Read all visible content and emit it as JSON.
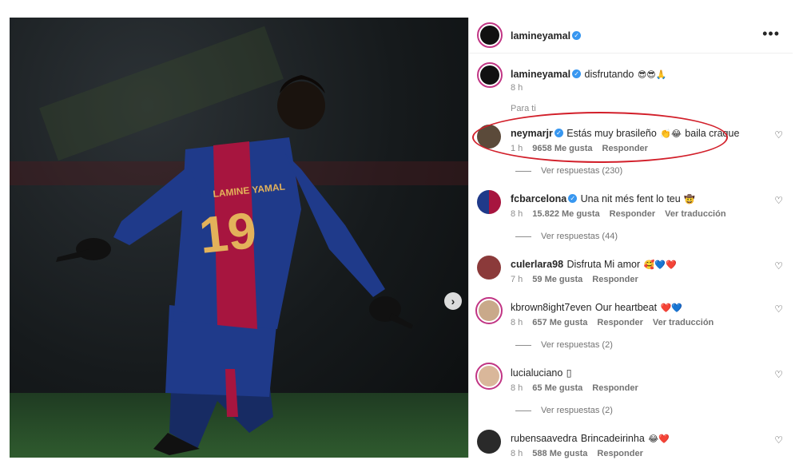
{
  "post": {
    "author": "lamineyamal",
    "caption": "disfrutando",
    "caption_emoji": "😎😎🙏",
    "caption_time": "8 h",
    "section_label": "Para ti"
  },
  "comments": [
    {
      "user": "neymarjr",
      "verified": true,
      "text": "Estás muy brasileño",
      "emoji1": "👏😂",
      "text2": "baila craque",
      "time": "1 h",
      "likes": "9658 Me gusta",
      "reply": "Responder",
      "translate": "",
      "view_replies": "Ver respuestas (230)"
    },
    {
      "user": "fcbarcelona",
      "verified": true,
      "text": "Una nit més fent lo teu",
      "emoji1": "🤠",
      "text2": "",
      "time": "8 h",
      "likes": "15.822 Me gusta",
      "reply": "Responder",
      "translate": "Ver traducción",
      "view_replies": "Ver respuestas (44)"
    },
    {
      "user": "culerlara98",
      "verified": false,
      "text": "Disfruta Mi amor",
      "emoji1": "🥰💙❤️",
      "text2": "",
      "time": "7 h",
      "likes": "59 Me gusta",
      "reply": "Responder",
      "translate": "",
      "view_replies": ""
    },
    {
      "user": "kbrown8ight7even",
      "verified": false,
      "text": "Our heartbeat",
      "emoji1": "❤️💙",
      "text2": "",
      "time": "8 h",
      "likes": "657 Me gusta",
      "reply": "Responder",
      "translate": "Ver traducción",
      "view_replies": "Ver respuestas (2)"
    },
    {
      "user": "lucialuciano",
      "verified": false,
      "text": "▯",
      "emoji1": "",
      "text2": "",
      "time": "8 h",
      "likes": "65 Me gusta",
      "reply": "Responder",
      "translate": "",
      "view_replies": "Ver respuestas (2)"
    },
    {
      "user": "rubensaavedra",
      "verified": false,
      "text": "Brincadeirinha",
      "emoji1": "😂❤️",
      "text2": "",
      "time": "8 h",
      "likes": "588 Me gusta",
      "reply": "Responder",
      "translate": "",
      "view_replies": ""
    }
  ],
  "jersey": {
    "name": "LAMINE YAMAL",
    "number": "19"
  },
  "colors": {
    "accent": "#3897f0",
    "annotation": "#d21f2a",
    "jersey_blue": "#1f3a8a",
    "jersey_red": "#a7153f"
  },
  "icons": {
    "verified": "verified-badge-icon",
    "heart": "heart-outline-icon",
    "more": "more-options-icon",
    "next": "chevron-right-icon"
  }
}
